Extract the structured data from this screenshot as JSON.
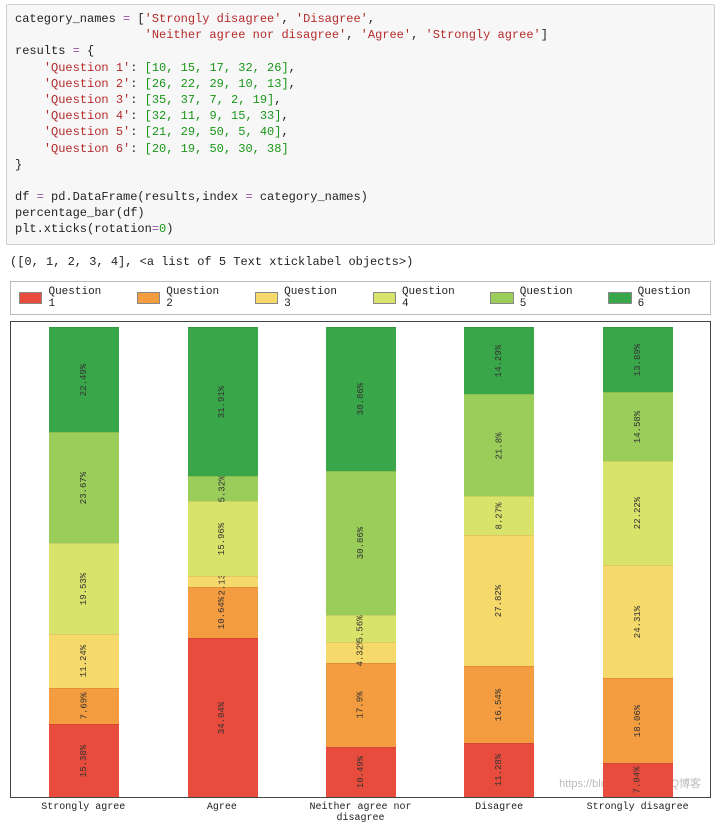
{
  "code": {
    "line1a": "category_names ",
    "eq": "=",
    "line1b": " [",
    "sd": "'Strongly disagree'",
    "comma": ", ",
    "d": "'Disagree'",
    "line1c": ",",
    "indent2": "                  ",
    "n": "'Neither agree nor disagree'",
    "a": "'Agree'",
    "sa": "'Strongly agree'",
    "closeBracket": "]",
    "results": "results ",
    "openBrace": " {",
    "q1": "'Question 1'",
    "q2": "'Question 2'",
    "q3": "'Question 3'",
    "q4": "'Question 4'",
    "q5": "'Question 5'",
    "q6": "'Question 6'",
    "colon": ": ",
    "q1v": "[10, 15, 17, 32, 26]",
    "q2v": "[26, 22, 29, 10, 13]",
    "q3v": "[35, 37, 7, 2, 19]",
    "q4v": "[32, 11, 9, 15, 33]",
    "q5v": "[21, 29, 50, 5, 40]",
    "q6v": "[20, 19, 50, 30, 38]",
    "closeBrace": "}",
    "dfline": "df ",
    "pd": " pd.DataFrame(results,index ",
    "cn": " category_names)",
    "pbar": "percentage_bar(df)",
    "plt": "plt.xticks(rotation",
    "zero": "0",
    "paren": ")"
  },
  "output": "([0, 1, 2, 3, 4], <a list of 5 Text xticklabel objects>)",
  "legend": {
    "q1": "Question 1",
    "q2": "Question 2",
    "q3": "Question 3",
    "q4": "Question 4",
    "q5": "Question 5",
    "q6": "Question 6"
  },
  "colors": {
    "q1": "#e74c3c",
    "q2": "#f39c40",
    "q3": "#f6d96b",
    "q4": "#d7e36a",
    "q5": "#9acd5a",
    "q6": "#3aa64a"
  },
  "chart_data": {
    "type": "bar",
    "stacked": true,
    "orientation": "vertical",
    "categories": [
      "Strongly agree",
      "Agree",
      "Neither agree nor disagree",
      "Disagree",
      "Strongly disagree"
    ],
    "series": [
      {
        "name": "Question 1",
        "values": [
          15.38,
          34.04,
          10.49,
          11.28,
          7.04
        ]
      },
      {
        "name": "Question 2",
        "values": [
          7.69,
          10.64,
          17.9,
          16.54,
          18.06
        ]
      },
      {
        "name": "Question 3",
        "values": [
          11.24,
          2.13,
          4.32,
          27.82,
          24.31
        ]
      },
      {
        "name": "Question 4",
        "values": [
          19.53,
          15.96,
          5.56,
          8.27,
          22.22
        ]
      },
      {
        "name": "Question 5",
        "values": [
          23.67,
          5.32,
          30.86,
          21.8,
          14.58
        ]
      },
      {
        "name": "Question 6",
        "values": [
          22.49,
          31.91,
          30.86,
          14.29,
          13.89
        ]
      }
    ],
    "labels": {
      "c0": [
        "15.38%",
        "7.69%",
        "11.24%",
        "19.53%",
        "23.67%",
        "22.49%"
      ],
      "c1": [
        "34.04%",
        "10.64%",
        "2.13%",
        "15.96%",
        "5.32%",
        "31.91%"
      ],
      "c2": [
        "10.49%",
        "17.9%",
        "4.32%",
        "5.56%",
        "30.86%",
        "30.86%"
      ],
      "c3": [
        "11.28%",
        "16.54%",
        "27.82%",
        "8.27%",
        "21.8%",
        "14.29%"
      ],
      "c4": [
        "7.04%",
        "18.06%",
        "24.31%",
        "22.22%",
        "14.58%",
        "13.89%"
      ]
    },
    "ylim": [
      0,
      100
    ]
  },
  "watermark": "https://blog.csdn.net/ITQ博客"
}
